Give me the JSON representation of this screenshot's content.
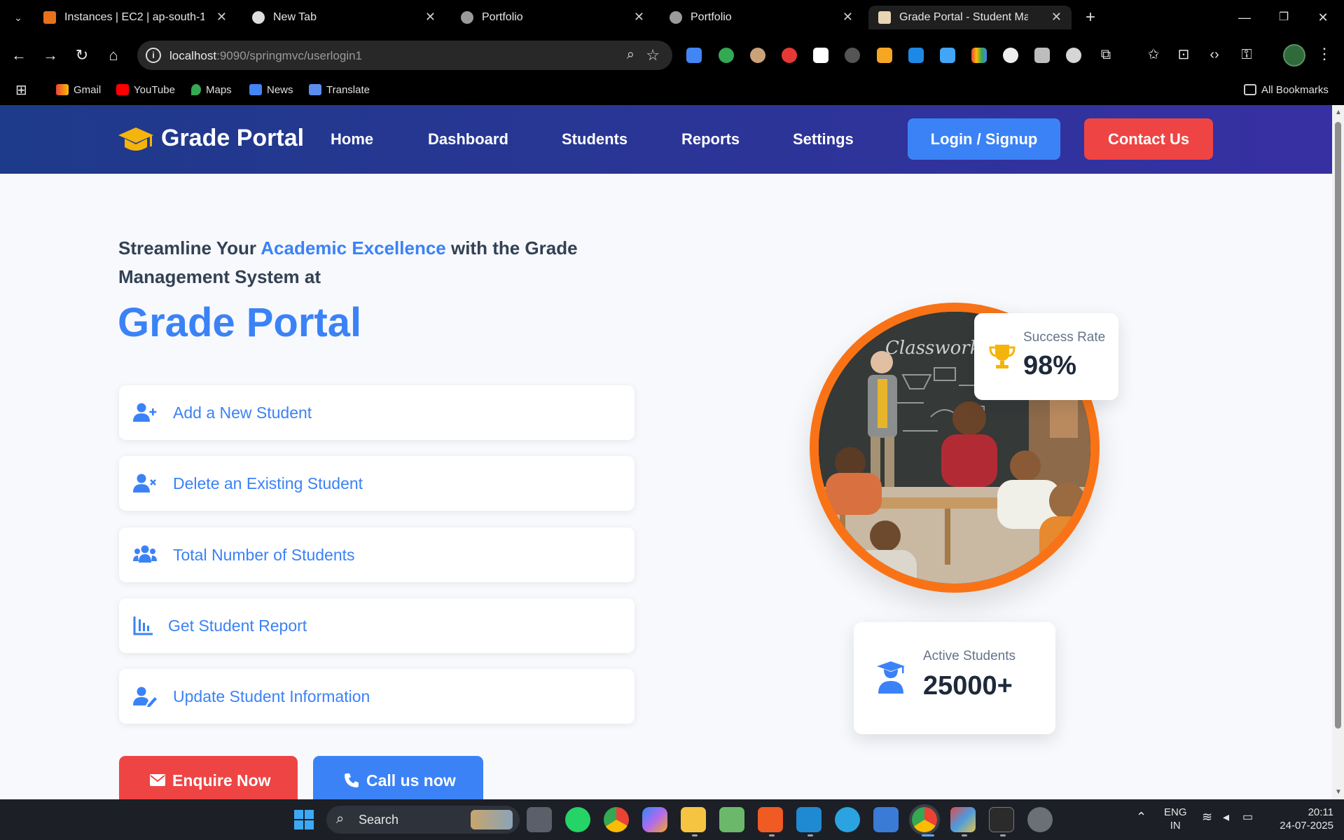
{
  "browser": {
    "tabs": [
      {
        "title": "Instances | EC2 | ap-south-1",
        "active": false
      },
      {
        "title": "New Tab",
        "active": false
      },
      {
        "title": "Portfolio",
        "active": false
      },
      {
        "title": "Portfolio",
        "active": false
      },
      {
        "title": "Grade Portal - Student Manage",
        "active": true
      }
    ],
    "url_host": "localhost",
    "url_path": ":9090/springmvc/userlogin1",
    "bookmarks": [
      "Gmail",
      "YouTube",
      "Maps",
      "News",
      "Translate"
    ],
    "all_bookmarks": "All Bookmarks"
  },
  "site": {
    "brand": "Grade Portal",
    "nav": [
      "Home",
      "Dashboard",
      "Students",
      "Reports",
      "Settings"
    ],
    "login_label": "Login / Signup",
    "contact_label": "Contact Us"
  },
  "hero": {
    "lead_part1": "Streamline Your ",
    "lead_highlight": "Academic Excellence",
    "lead_part2": " with the Grade Management System at",
    "title": "Grade Portal",
    "actions": [
      {
        "label": "Add a New Student",
        "icon": "user-plus-icon"
      },
      {
        "label": "Delete an Existing Student",
        "icon": "user-remove-icon"
      },
      {
        "label": "Total Number of Students",
        "icon": "users-icon"
      },
      {
        "label": "Get Student Report",
        "icon": "bar-chart-icon"
      },
      {
        "label": "Update Student Information",
        "icon": "user-edit-icon"
      }
    ],
    "enquire_label": "Enquire Now",
    "call_label": "Call us now"
  },
  "stats": {
    "success_label": "Success Rate",
    "success_value": "98%",
    "active_label": "Active Students",
    "active_value": "25000+"
  },
  "taskbar": {
    "search_label": "Search",
    "lang_top": "ENG",
    "lang_bottom": "IN",
    "time": "20:11",
    "date": "24-07-2025"
  },
  "colors": {
    "primary": "#3b82f6",
    "danger": "#ef4444",
    "accent_ring": "#f97316",
    "nav_gradient_start": "#1e3a8a",
    "nav_gradient_end": "#3730a3"
  }
}
